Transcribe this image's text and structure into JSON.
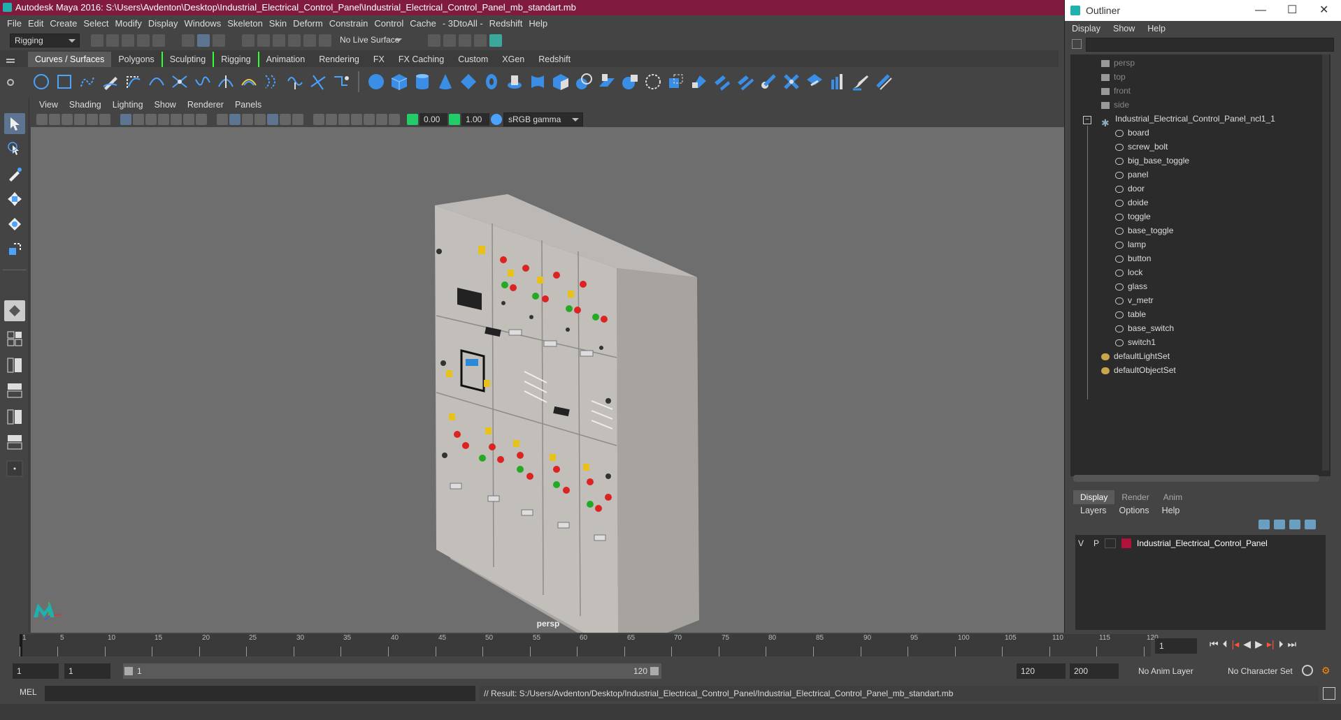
{
  "window": {
    "title": "Autodesk Maya 2016: S:\\Users\\Avdenton\\Desktop\\Industrial_Electrical_Control_Panel\\Industrial_Electrical_Control_Panel_mb_standart.mb"
  },
  "menubar": [
    "File",
    "Edit",
    "Create",
    "Select",
    "Modify",
    "Display",
    "Windows",
    "Skeleton",
    "Skin",
    "Deform",
    "Constrain",
    "Control",
    "Cache",
    "- 3DtoAll -",
    "Redshift",
    "Help"
  ],
  "statusline": {
    "mode": "Rigging",
    "live_surface": "No Live Surface"
  },
  "shelf_tabs": [
    {
      "label": "Curves / Surfaces",
      "active": true
    },
    {
      "label": "Polygons"
    },
    {
      "label": "Sculpting"
    },
    {
      "label": "Rigging"
    },
    {
      "label": "Animation"
    },
    {
      "label": "Rendering"
    },
    {
      "label": "FX"
    },
    {
      "label": "FX Caching"
    },
    {
      "label": "Custom"
    },
    {
      "label": "XGen"
    },
    {
      "label": "Redshift"
    }
  ],
  "viewport": {
    "menu": [
      "View",
      "Shading",
      "Lighting",
      "Show",
      "Renderer",
      "Panels"
    ],
    "exposure": "0.00",
    "gamma": "1.00",
    "color_space": "sRGB gamma",
    "camera_label": "persp"
  },
  "outliner": {
    "title": "Outliner",
    "menu": [
      "Display",
      "Show",
      "Help"
    ],
    "cameras": [
      "persp",
      "top",
      "front",
      "side"
    ],
    "group": "Industrial_Electrical_Control_Panel_ncl1_1",
    "children": [
      "board",
      "screw_bolt",
      "big_base_toggle",
      "panel",
      "door",
      "doide",
      "toggle",
      "base_toggle",
      "lamp",
      "button",
      "lock",
      "glass",
      "v_metr",
      "table",
      "base_switch",
      "switch1"
    ],
    "sets": [
      "defaultLightSet",
      "defaultObjectSet"
    ]
  },
  "layer_editor": {
    "tabs": [
      {
        "label": "Display",
        "active": true
      },
      {
        "label": "Render"
      },
      {
        "label": "Anim"
      }
    ],
    "menu": [
      "Layers",
      "Options",
      "Help"
    ],
    "layer": {
      "v": "V",
      "p": "P",
      "name": "Industrial_Electrical_Control_Panel",
      "color": "#b0133a"
    }
  },
  "timeline": {
    "ticks": [
      "1",
      "5",
      "10",
      "15",
      "20",
      "25",
      "30",
      "35",
      "40",
      "45",
      "50",
      "55",
      "60",
      "65",
      "70",
      "75",
      "80",
      "85",
      "90",
      "95",
      "100",
      "105",
      "110",
      "115",
      "120"
    ],
    "current_frame": "1"
  },
  "range": {
    "start": "1",
    "start2": "1",
    "slider_start": "1",
    "slider_end": "120",
    "end": "120",
    "end2": "200",
    "anim_layer": "No Anim Layer",
    "char_set": "No Character Set"
  },
  "cmdline": {
    "lang": "MEL",
    "result": "// Result: S:/Users/Avdenton/Desktop/Industrial_Electrical_Control_Panel/Industrial_Electrical_Control_Panel_mb_standart.mb"
  }
}
